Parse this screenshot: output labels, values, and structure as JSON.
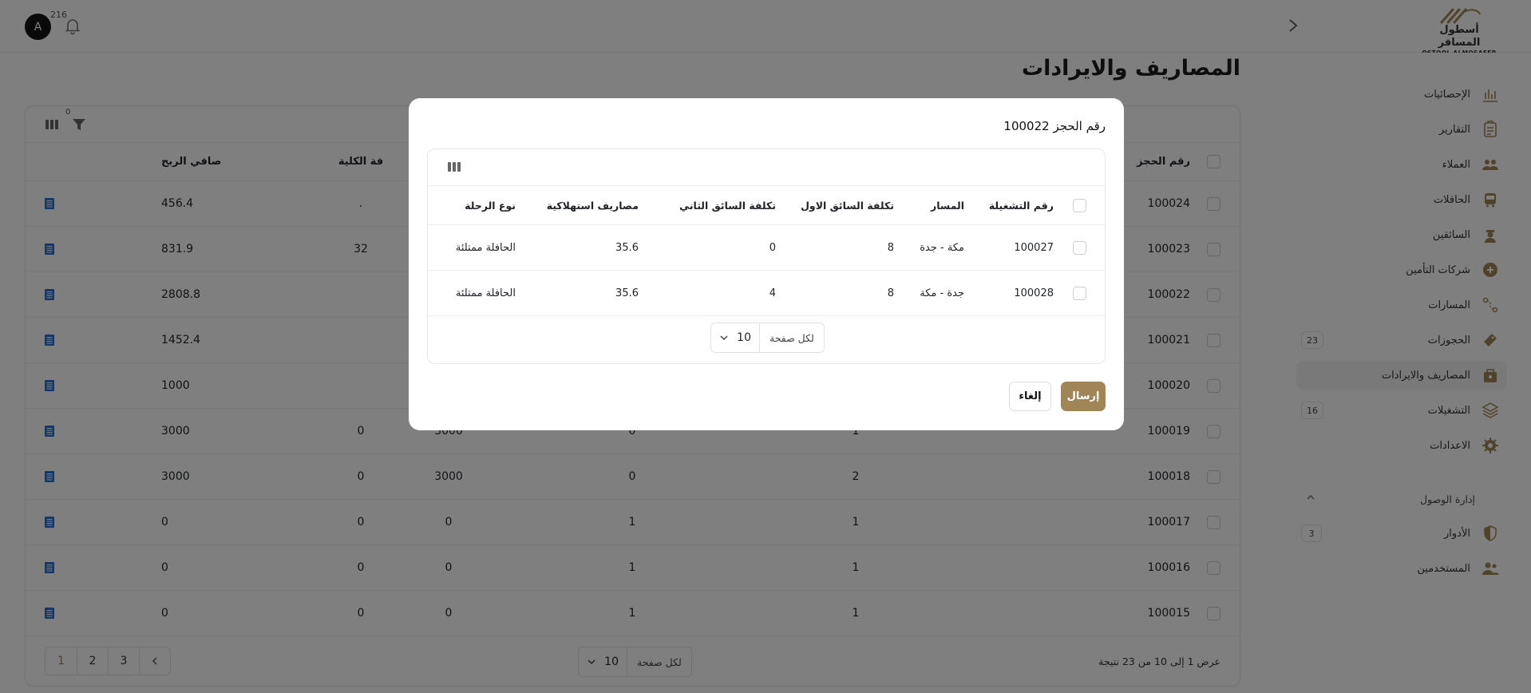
{
  "brand": {
    "name_ar": "أسطول المسافر",
    "name_en": "OSTOOL ALMOSAFER",
    "color": "#a08656"
  },
  "header": {
    "avatar_initial": "A",
    "notifications_count": "216"
  },
  "sidebar": {
    "items": [
      {
        "label": "الإحصائيات",
        "icon": "chart-icon"
      },
      {
        "label": "التقارير",
        "icon": "clipboard-icon"
      },
      {
        "label": "العملاء",
        "icon": "customers-icon"
      },
      {
        "label": "الحافلات",
        "icon": "bus-icon"
      },
      {
        "label": "السائقين",
        "icon": "driver-icon"
      },
      {
        "label": "شركات التأمين",
        "icon": "shield-plus-icon"
      },
      {
        "label": "المسارات",
        "icon": "route-icon"
      },
      {
        "label": "الحجوزات",
        "icon": "ticket-icon",
        "badge": "23"
      },
      {
        "label": "المصاريف والايرادات",
        "icon": "wallet-icon"
      },
      {
        "label": "التشغيلات",
        "icon": "layers-icon",
        "badge": "16"
      },
      {
        "label": "الاعدادات",
        "icon": "settings-icon"
      }
    ],
    "access_section": "إدارة الوصول",
    "access_items": [
      {
        "label": "الأدوار",
        "icon": "role-shield-icon",
        "badge": "3"
      },
      {
        "label": "المستخدمين",
        "icon": "users-icon"
      }
    ]
  },
  "page": {
    "title": "المصاريف والايرادات"
  },
  "table": {
    "filter_count": "0",
    "headers": {
      "booking_no": "رقم الحجز",
      "total_cost": "التكلفة الكلية",
      "net_profit": "صافي الربح",
      "total_cost_visible": "فة الكلية"
    },
    "rows": [
      {
        "id": "100024",
        "ops": "",
        "d1": "",
        "d2": "",
        "d3": "",
        "d4": ".",
        "profit": "456.4"
      },
      {
        "id": "100023",
        "ops": "",
        "d1": "",
        "d2": "",
        "d3": "",
        "d4": "32",
        "profit": "831.9"
      },
      {
        "id": "100022",
        "ops": "",
        "d1": "",
        "d2": "",
        "d3": "",
        "d4": "",
        "profit": "2808.8"
      },
      {
        "id": "100021",
        "ops": "",
        "d1": "",
        "d2": "",
        "d3": "",
        "d4": "",
        "profit": "1452.4"
      },
      {
        "id": "100020",
        "ops": "",
        "d1": "",
        "d2": "",
        "d3": "",
        "d4": "",
        "profit": "1000"
      },
      {
        "id": "100019",
        "ops": "1",
        "d1": "0",
        "d2": "",
        "d3": "3000",
        "d4": "0",
        "profit": "3000"
      },
      {
        "id": "100018",
        "ops": "2",
        "d1": "0",
        "d2": "",
        "d3": "3000",
        "d4": "0",
        "profit": "3000"
      },
      {
        "id": "100017",
        "ops": "1",
        "d1": "1",
        "d2": "",
        "d3": "0",
        "d4": "0",
        "profit": "0"
      },
      {
        "id": "100016",
        "ops": "1",
        "d1": "1",
        "d2": "",
        "d3": "0",
        "d4": "0",
        "profit": "0"
      },
      {
        "id": "100015",
        "ops": "1",
        "d1": "1",
        "d2": "",
        "d3": "0",
        "d4": "0",
        "profit": "0"
      }
    ],
    "per_page_label": "لكل صفحة",
    "per_page_value": "10",
    "result_text": "عرض 1 إلى 10 من 23 نتيجة",
    "pages": [
      "1",
      "2",
      "3"
    ]
  },
  "modal": {
    "title": "رقم الحجز 100022",
    "headers": {
      "op_no": "رقم التشغيلة",
      "route": "المسار",
      "driver1_cost": "تكلفة السائق الاول",
      "driver2_cost": "تكلفة السائق الثاني",
      "consumables": "مصاريف استهلاكية",
      "trip_type": "نوع الرحلة"
    },
    "rows": [
      {
        "op_no": "100027",
        "route": "مكة - جدة",
        "driver1_cost": "8",
        "driver2_cost": "0",
        "consumables": "35.6",
        "trip_type": "الحافلة ممتلئة"
      },
      {
        "op_no": "100028",
        "route": "جدة - مكة",
        "driver1_cost": "8",
        "driver2_cost": "4",
        "consumables": "35.6",
        "trip_type": "الحافلة ممتلئة"
      }
    ],
    "per_page_label": "لكل صفحة",
    "per_page_value": "10",
    "send_label": "إرسال",
    "cancel_label": "إلغاء"
  }
}
